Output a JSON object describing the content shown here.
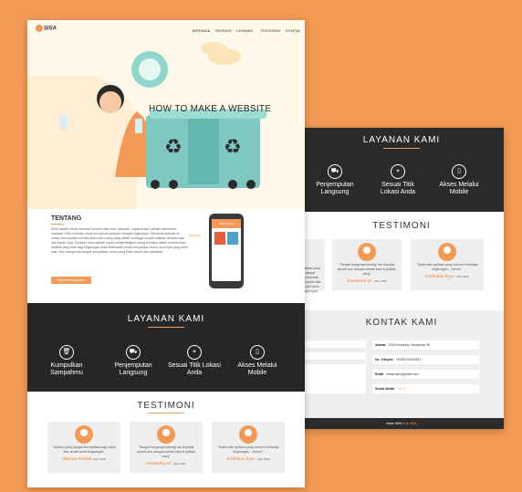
{
  "colors": {
    "accent": "#f39a56",
    "dark": "#262626"
  },
  "nav": {
    "logo": "SISA",
    "items": [
      "BERANDA",
      "TENTANG",
      "LAYANAN",
      "TESTIMONI",
      "KONTAK"
    ]
  },
  "hero": {
    "headline": "HOW TO MAKE A WEBSITE"
  },
  "about": {
    "title": "TENTANG",
    "body": "SISA adalah bisnis rekonsel berbasi atas bank Sampah. Layana bank adalah membantu nasabah SISA sedaftar untuk mengelola sampah menjadi lingkungan. Membuat aplikasi ini untuk menciptakan kondisi alami dan ruang yang efektif sehingga mudah diakses dimana saja dan kapan saja. Harapan kami adalah untuk menghilangkan ruang terbatas dalam memberikan fasilitas yang baik bagi lingkungan serta kesehatan untuk menjadikan dunia ini lumpat yang lebih baik. Mari bangun semangat menjadikan dunia yang lebih bersih dan sejahtera.",
    "button": "Lihat lebih lengkap >",
    "phone_title": "Seller & Jual"
  },
  "services": {
    "title": "LAYANAN KAMI",
    "items": [
      {
        "icon": "trash-icon",
        "label": "Kumpulkan Sampahmu"
      },
      {
        "icon": "truck-icon",
        "label": "Penjemputan Langsung"
      },
      {
        "icon": "location-icon",
        "label": "Sesuai Titik Lokasi Anda"
      },
      {
        "icon": "phone-icon",
        "label": "Akses Melalui Mobile"
      }
    ]
  },
  "testimoni": {
    "title": "TESTIMONI",
    "items": [
      {
        "quote": "\"Aplikasi yang sangat bermanfaat bagi untuk kita sendiri serta lingkungan\"",
        "name": "Shasna Pratiwi",
        "role": "User SISA"
      },
      {
        "quote": "\"Sangat bangunya barang! tak terpakai seperti dus ataupun kertas bisa di jadikan uang\"",
        "name": "Kumbohu 07",
        "role": "User SISA"
      },
      {
        "quote": "\"Salah satu aplikasi yang concern terhadap lingkungan.....keren!\"",
        "name": "Andhikan Ilyas",
        "role": "User SISA"
      }
    ]
  },
  "contact": {
    "title": "KONTAK KAMI",
    "fields": [
      {
        "label": "Alamat",
        "value": "SISA Bandung, Bangunan 96"
      },
      {
        "label": "No. Telepon",
        "value": "+6285719515851"
      },
      {
        "label": "Email",
        "value": "sisaprojek@gmail.com"
      },
      {
        "label": "Social Media",
        "value": "f  ✉  ◎"
      }
    ]
  },
  "footer": {
    "text": "Made With",
    "brand": "by SISA"
  }
}
